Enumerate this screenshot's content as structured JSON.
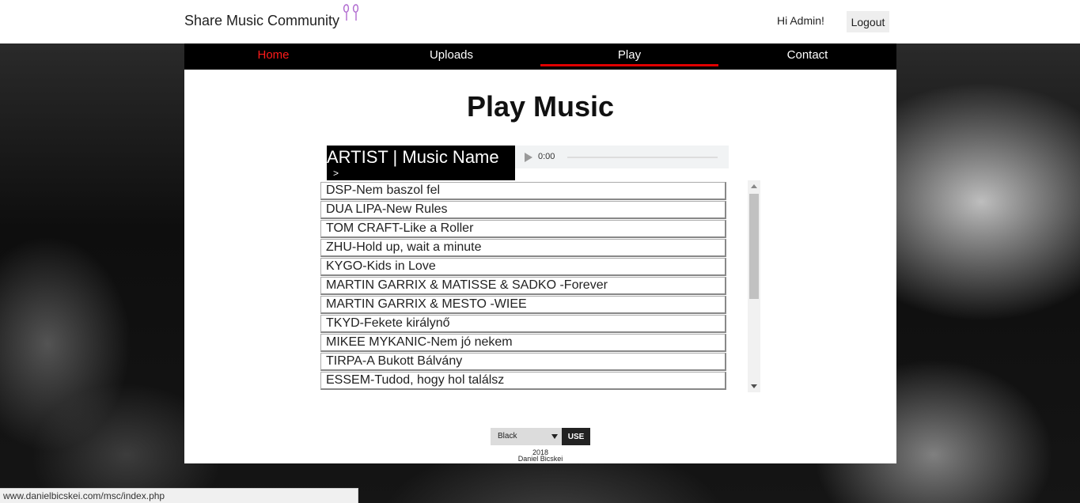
{
  "header": {
    "brand": "Share Music Community",
    "brand_icon": "earphones-icon",
    "greeting": "Hi Admin!",
    "logout_label": "Logout"
  },
  "nav": {
    "items": [
      {
        "label": "Home"
      },
      {
        "label": "Uploads"
      },
      {
        "label": "Play"
      },
      {
        "label": "Contact"
      }
    ],
    "current": "Play",
    "colors": {
      "home": "#ff1a1a",
      "underline": "#e00000",
      "bar": "#000000"
    }
  },
  "main": {
    "title": "Play Music",
    "now_playing": {
      "title": "ARTIST | Music Name",
      "arrow": ">"
    },
    "audio": {
      "time": "0:00"
    },
    "songs": [
      "DSP-Nem baszol fel",
      "DUA LIPA-New Rules",
      "TOM CRAFT-Like a Roller",
      "ZHU-Hold up, wait a minute",
      "KYGO-Kids in Love",
      "MARTIN GARRIX & MATISSE & SADKO -Forever",
      "MARTIN GARRIX & MESTO -WIEE",
      "TKYD-Fekete királynő",
      "MIKEE MYKANIC-Nem jó nekem",
      "TIRPA-A Bukott Bálvány",
      "ESSEM-Tudod, hogy hol találsz"
    ],
    "theme": {
      "selected": "Black",
      "use_label": "USE"
    }
  },
  "footer": {
    "year": "2018",
    "author": "Daniel Bicskei"
  },
  "status_bar": {
    "url": "www.danielbicskei.com/msc/index.php"
  }
}
